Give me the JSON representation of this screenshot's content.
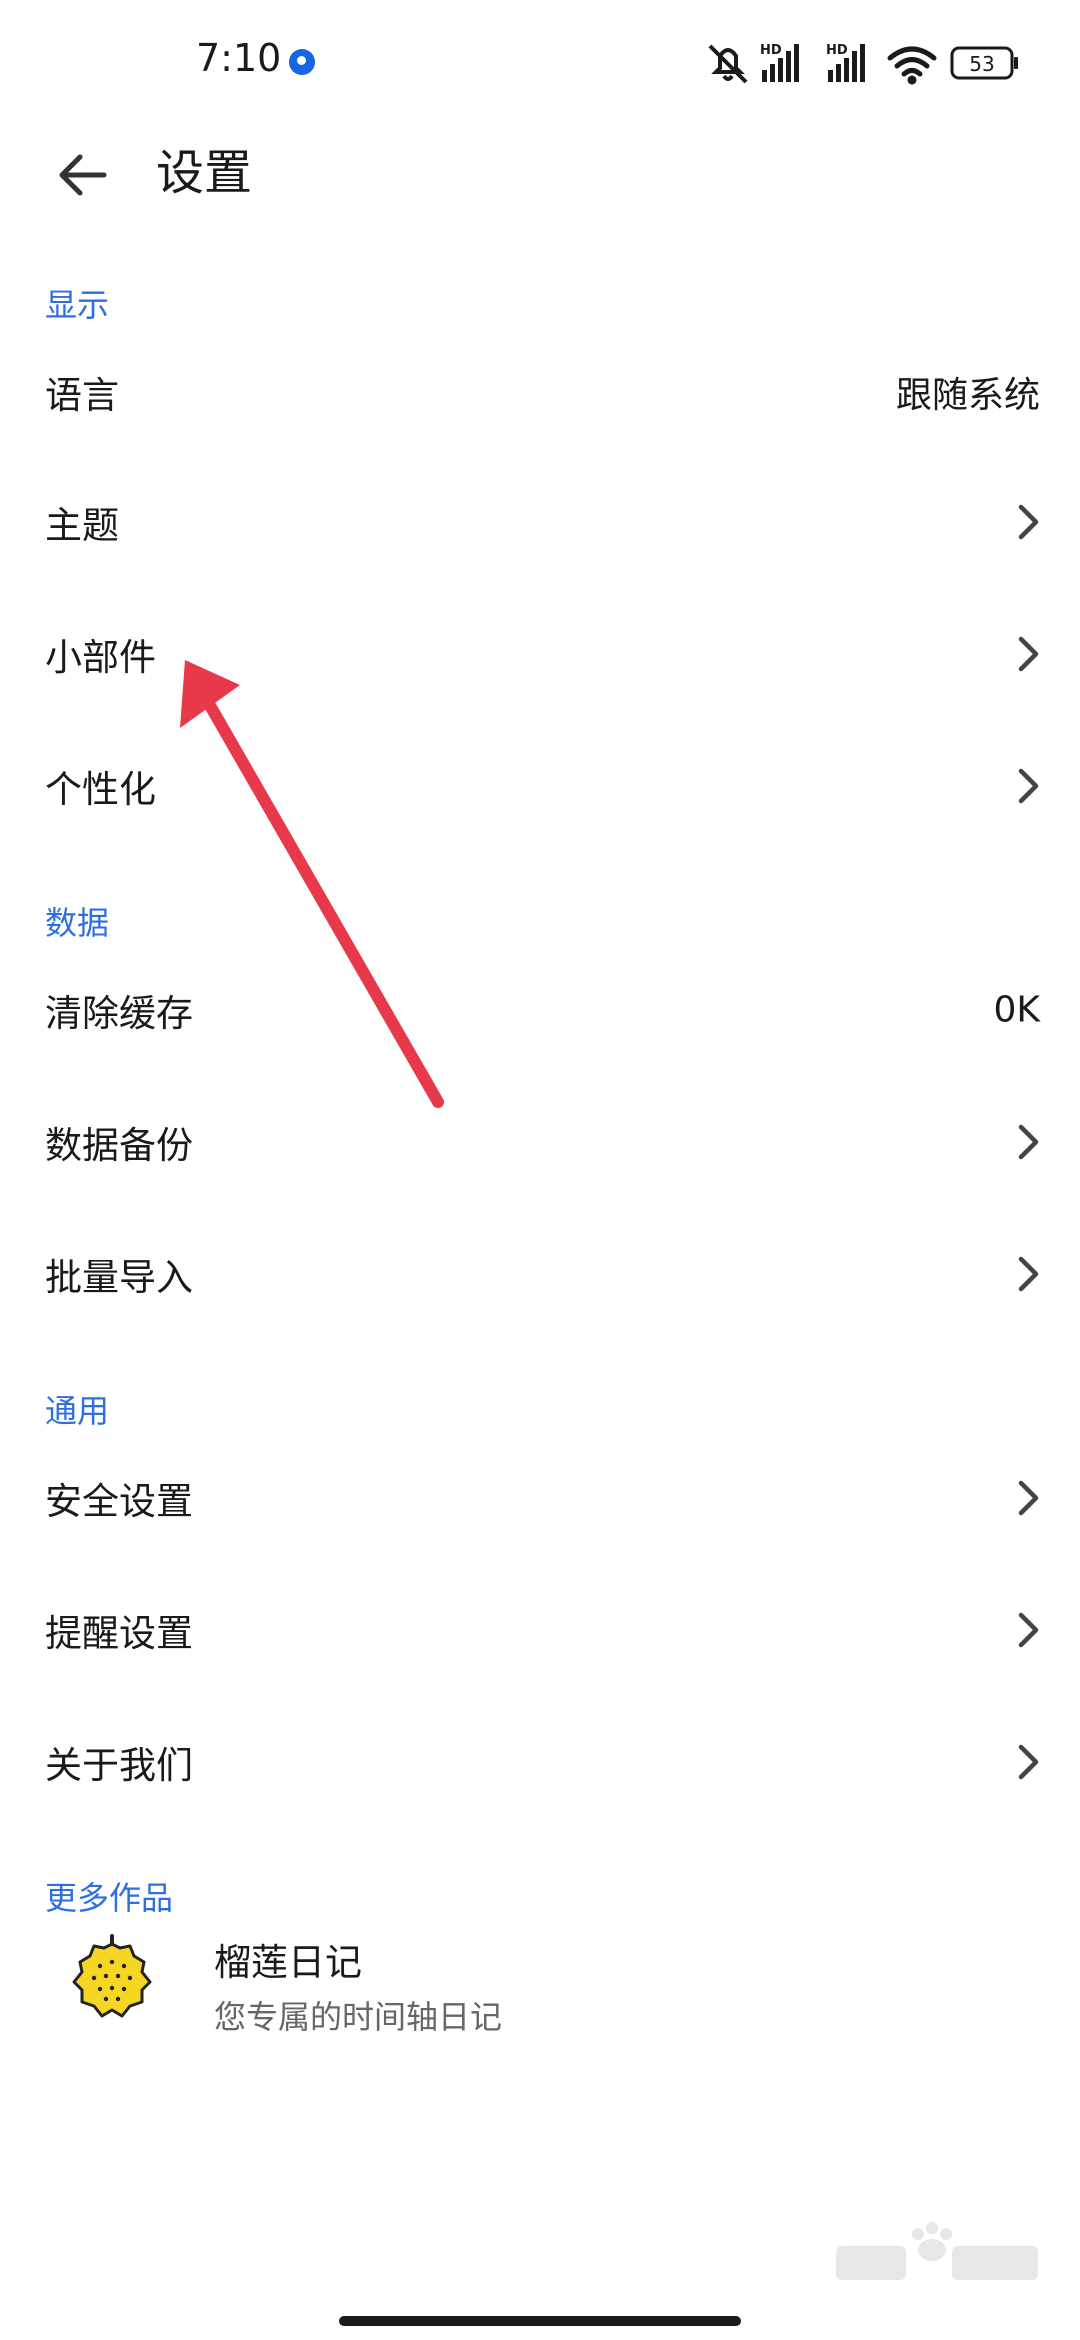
{
  "status_bar": {
    "time": "7:10",
    "battery": "53",
    "net1": "HD",
    "net2": "HD",
    "icons": [
      "notification-app-icon",
      "mute-icon",
      "signal-icon",
      "signal-icon",
      "wifi-icon",
      "battery-icon"
    ]
  },
  "header": {
    "title": "设置",
    "back_icon": "arrow-left-icon"
  },
  "sections": {
    "display": {
      "label": "显示",
      "items": [
        {
          "label": "语言",
          "value": "跟随系统"
        },
        {
          "label": "主题"
        },
        {
          "label": "小部件"
        },
        {
          "label": "个性化"
        }
      ]
    },
    "data": {
      "label": "数据",
      "items": [
        {
          "label": "清除缓存",
          "value": "0K"
        },
        {
          "label": "数据备份"
        },
        {
          "label": "批量导入"
        }
      ]
    },
    "general": {
      "label": "通用",
      "items": [
        {
          "label": "安全设置"
        },
        {
          "label": "提醒设置"
        },
        {
          "label": "关于我们"
        }
      ]
    },
    "more": {
      "label": "更多作品",
      "app": {
        "title": "榴莲日记",
        "subtitle": "您专属的时间轴日记",
        "icon": "durian-icon"
      }
    }
  },
  "colors": {
    "accent": "#2f6ee0",
    "annotation": "#e8394a"
  }
}
